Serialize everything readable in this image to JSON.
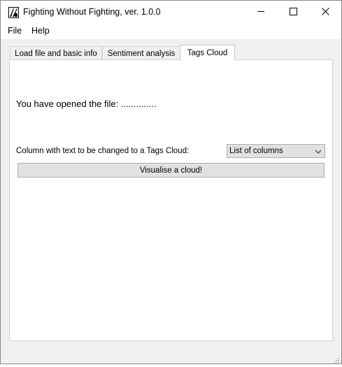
{
  "window": {
    "title": "Fighting Without Fighting, ver. 1.0.0"
  },
  "menu": {
    "file": "File",
    "help": "Help"
  },
  "tabs": [
    {
      "label": "Load file and basic info"
    },
    {
      "label": "Sentiment analysis"
    },
    {
      "label": "Tags Cloud"
    }
  ],
  "active_tab": "Tags Cloud",
  "content": {
    "opened_file_text": "You have opened the file:  ..............",
    "column_label": "Column with text to be changed to a Tags Cloud:",
    "column_select_value": "List of columns",
    "visualise_button": "Visualise a cloud!"
  },
  "icons": {
    "app": "app-icon",
    "minimize": "minimize-icon",
    "maximize": "maximize-icon",
    "close": "close-icon",
    "dropdown": "chevron-down-icon",
    "resize": "resize-grip-icon"
  }
}
